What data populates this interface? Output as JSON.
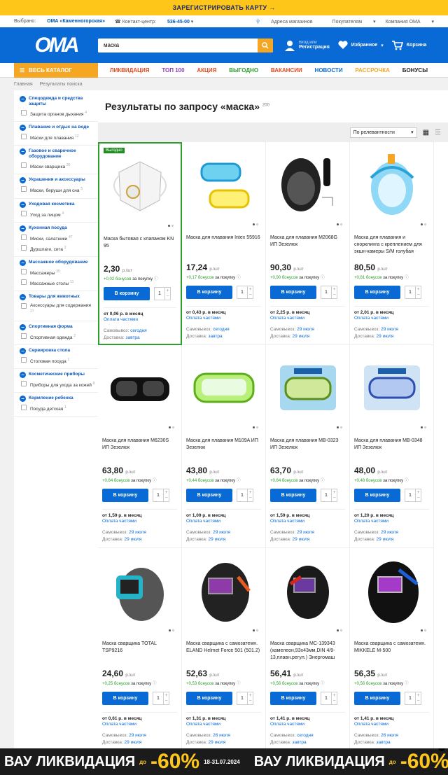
{
  "topbar": {
    "label": "ЗАРЕГИСТРИРОВАТЬ КАРТУ →"
  },
  "infobar": {
    "selected_label": "Выбрано:",
    "selected_store": "ОМА «Каменногорская»",
    "contact_label": "Контакт-центр:",
    "contact_phone": "536-45-00",
    "stores": "Адреса магазинов",
    "buyers": "Покупателям",
    "company": "Компания ОМА"
  },
  "header": {
    "logo": "ОМА",
    "search_value": "маска",
    "login_small": "Вход или",
    "login": "Регистрация",
    "favorites": "Избранное",
    "cart": "Корзина"
  },
  "nav": {
    "catalog": "ВЕСЬ КАТАЛОГ",
    "links": [
      {
        "label": "ЛИКВИДАЦИЯ",
        "color": "#e2491b"
      },
      {
        "label": "ТОП 100",
        "color": "#8b3fb8"
      },
      {
        "label": "АКЦИЯ",
        "color": "#e2491b"
      },
      {
        "label": "ВЫГОДНО",
        "color": "#2ca02c"
      },
      {
        "label": "ВАКАНСИИ",
        "color": "#e2491b"
      },
      {
        "label": "НОВОСТИ",
        "color": "#0a6ad5"
      },
      {
        "label": "РАССРОЧКА",
        "color": "#f5a623"
      },
      {
        "label": "БОНУСЫ",
        "color": "#222"
      }
    ]
  },
  "breadcrumbs": [
    "Главная",
    "Результаты поиска"
  ],
  "sidebar": [
    {
      "title": "Спецодежда и средства защиты",
      "items": [
        {
          "label": "Защита органов дыхания",
          "count": "4"
        }
      ]
    },
    {
      "title": "Плавание и отдых на воде",
      "items": [
        {
          "label": "Маски для плавания",
          "count": "12"
        }
      ]
    },
    {
      "title": "Газовое и сварочное оборудование",
      "items": [
        {
          "label": "Маски сварщика",
          "count": "30"
        }
      ]
    },
    {
      "title": "Украшения и аксессуары",
      "items": [
        {
          "label": "Маски, беруши для сна",
          "count": "5"
        }
      ]
    },
    {
      "title": "Уходовая косметика",
      "items": [
        {
          "label": "Уход за лицом",
          "count": "4"
        }
      ]
    },
    {
      "title": "Кухонная посуда",
      "items": [
        {
          "label": "Миски, салатники",
          "count": "47"
        },
        {
          "label": "Дуршлаги, сита",
          "count": "2"
        }
      ]
    },
    {
      "title": "Массажное оборудование",
      "items": [
        {
          "label": "Массажеры",
          "count": "35"
        },
        {
          "label": "Массажные столы",
          "count": "11"
        }
      ]
    },
    {
      "title": "Товары для животных",
      "items": [
        {
          "label": "Аксессуары для содержания",
          "count": "27"
        }
      ]
    },
    {
      "title": "Спортивная форма",
      "items": [
        {
          "label": "Спортивная одежда",
          "count": "2"
        }
      ]
    },
    {
      "title": "Сервировка стола",
      "items": [
        {
          "label": "Столовая посуда",
          "count": "1"
        }
      ]
    },
    {
      "title": "Косметические приборы",
      "items": [
        {
          "label": "Приборы для ухода за кожей",
          "count": "8"
        }
      ]
    },
    {
      "title": "Кормление ребенка",
      "items": [
        {
          "label": "Посуда детская",
          "count": "1"
        }
      ]
    }
  ],
  "results": {
    "title": "Результаты по запросу «маска»",
    "count": "200",
    "sort": "По релевантности"
  },
  "labels": {
    "unit": "р./шт",
    "bonus_suffix": "за покупку",
    "buy": "В корзину",
    "qty": "1",
    "installments": "Оплата частями",
    "pickup": "Самовывоз:",
    "delivery": "Доставка:"
  },
  "products": [
    {
      "name": "Маска бытовая с клапаном KN 95",
      "price": "2,30",
      "bonus": "+0,02 бонусов",
      "month": "от 0,06 р. в месяц",
      "pickup": "сегодня",
      "delivery": "завтра",
      "badge": "Выгодно",
      "img": "respirator"
    },
    {
      "name": "Маска для плавания Intex 55916",
      "price": "17,24",
      "bonus": "+0,17 бонусов",
      "month": "от 0,43 р. в месяц",
      "pickup": "сегодня",
      "delivery": "завтра",
      "img": "swimpair"
    },
    {
      "name": "Маска для плавания M2068G ИП Зезелюк",
      "price": "90,30",
      "bonus": "+0,90 бонусов",
      "month": "от 2,25 р. в месяц",
      "pickup": "29 июля",
      "delivery": "29 июля",
      "img": "fullface-black"
    },
    {
      "name": "Маска для плавания и снорклинга с креплением для экшн-камеры S/M голубая",
      "price": "80,50",
      "bonus": "+0,81 бонусов",
      "month": "от 2,01 р. в месяц",
      "pickup": "29 июля",
      "delivery": "29 июля",
      "img": "fullface-blue"
    },
    {
      "name": "Маска для плавания M6230S ИП Зезелюк",
      "price": "63,80",
      "bonus": "+0,64 бонусов",
      "month": "от 1,59 р. в месяц",
      "pickup": "29 июля",
      "delivery": "29 июля",
      "img": "dive-black"
    },
    {
      "name": "Маска для плавания M109A ИП Зезелюк",
      "price": "43,80",
      "bonus": "+0,44 бонусов",
      "month": "от 1,09 р. в месяц",
      "pickup": "29 июля",
      "delivery": "29 июля",
      "img": "dive-green"
    },
    {
      "name": "Маска для плавания MB-0323 ИП Зезелюк",
      "price": "63,70",
      "bonus": "+0,64 бонусов",
      "month": "от 1,59 р. в месяц",
      "pickup": "29 июля",
      "delivery": "29 июля",
      "img": "pack-green"
    },
    {
      "name": "Маска для плавания MB-0348 ИП Зезелюк",
      "price": "48,00",
      "bonus": "+0,48 бонусов",
      "month": "от 1,20 р. в месяц",
      "pickup": "29 июля",
      "delivery": "29 июля",
      "img": "pack-blue"
    },
    {
      "name": "Маска сварщика TOTAL TSP9216",
      "price": "24,60",
      "bonus": "+0,25 бонусов",
      "month": "от 0,61 р. в месяц",
      "pickup": "29 июля",
      "delivery": "29 июля",
      "img": "weld-teal"
    },
    {
      "name": "Маска сварщика с самозатемн. ELAND Helmet Force 501 (501.2)",
      "price": "52,63",
      "bonus": "+0,53 бонусов",
      "month": "от 1,31 р. в месяц",
      "pickup": "26 июля",
      "delivery": "29 июля",
      "img": "weld-orange"
    },
    {
      "name": "Маска сварщика MC-139343 (хамелеон,93х43мм,DIN 4/9-13,плавн.регул.) Энергомаш",
      "price": "56,41",
      "bonus": "+0,56 бонусов",
      "month": "от 1,41 р. в месяц",
      "pickup": "сегодня",
      "delivery": "завтра",
      "img": "weld-red"
    },
    {
      "name": "Маска сварщика с самозатемн. MIKKELE M-500",
      "price": "56,35",
      "bonus": "+0,56 бонусов",
      "month": "от 1,41 р. в месяц",
      "pickup": "26 июля",
      "delivery": "завтра",
      "img": "weld-blue"
    }
  ],
  "banner": {
    "text1": "ВАУ",
    "text2": "ЛИКВИДАЦИЯ",
    "upto": "до",
    "pct": "-60%",
    "dates": "18-31.07.2024",
    "close": "×"
  }
}
